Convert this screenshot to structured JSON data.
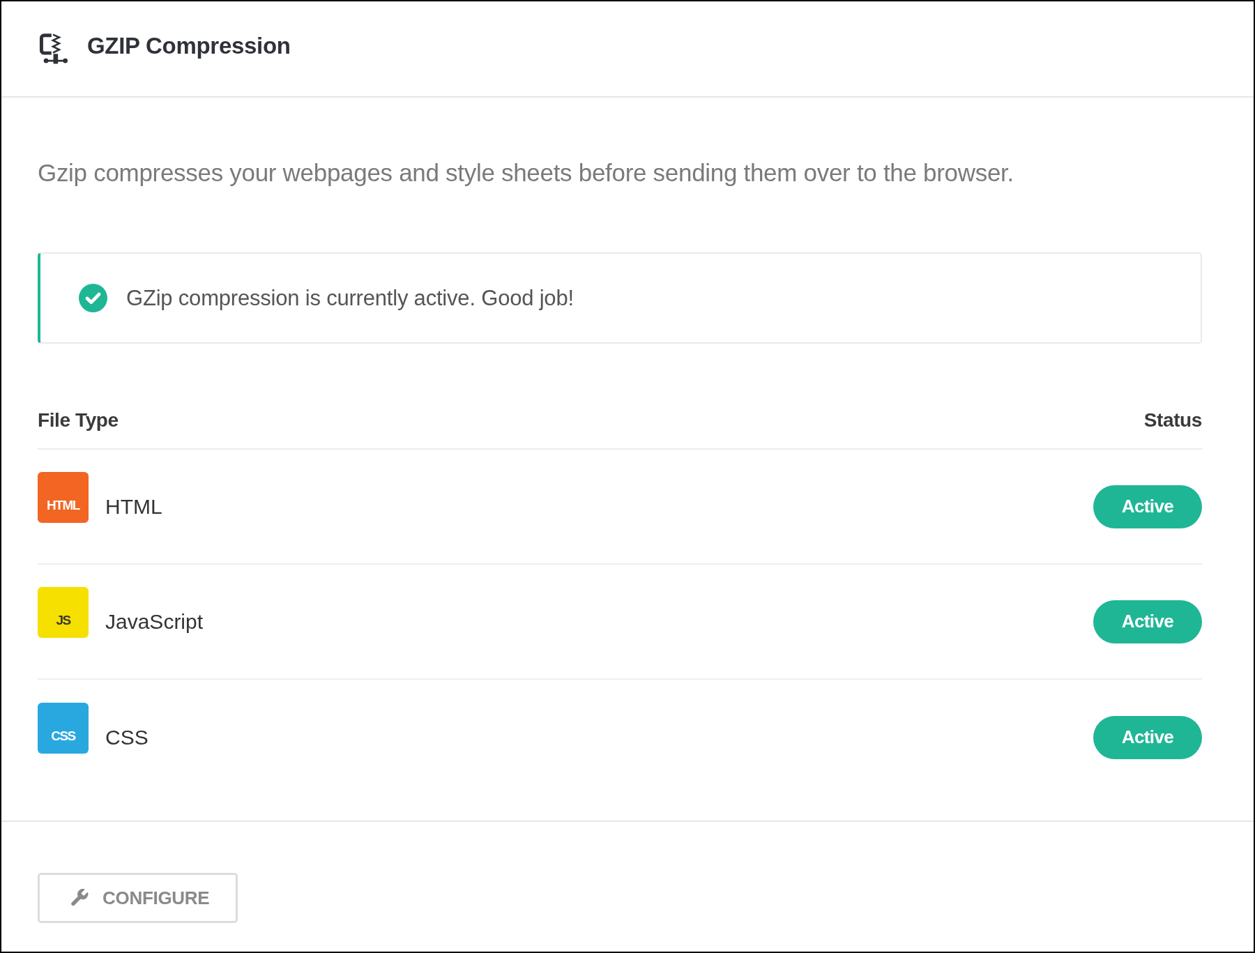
{
  "header": {
    "title": "GZIP Compression"
  },
  "description": "Gzip compresses your webpages and style sheets before sending them over to the browser.",
  "notice": {
    "kind": "success",
    "text": "GZip compression is currently active. Good job!"
  },
  "table": {
    "columns": [
      "File Type",
      "Status"
    ],
    "rows": [
      {
        "logo": "HTML",
        "color": "#f26522",
        "name": "HTML",
        "status": "Active",
        "active": true
      },
      {
        "logo": "JS",
        "color": "#f5e000",
        "name": "JavaScript",
        "status": "Active",
        "active": true
      },
      {
        "logo": "CSS",
        "color": "#29a8e0",
        "name": "CSS",
        "status": "Active",
        "active": true
      }
    ]
  },
  "footer": {
    "button": "CONFIGURE"
  }
}
